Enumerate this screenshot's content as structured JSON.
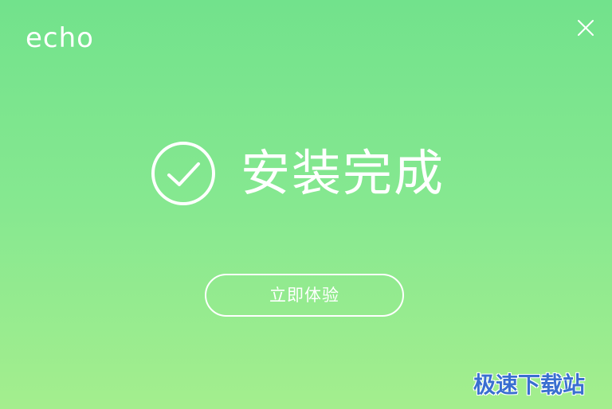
{
  "app": {
    "logo_text": "echo"
  },
  "window_controls": {
    "close_icon": "close-icon"
  },
  "main": {
    "status_icon": "check-circle-icon",
    "title": "安装完成",
    "action_button_label": "立即体验"
  },
  "watermark": {
    "text": "极速下载站"
  },
  "colors": {
    "background_top": "#72e28c",
    "background_bottom": "#a4ee8e",
    "foreground": "#ffffff",
    "watermark": "#3a6fd0"
  }
}
